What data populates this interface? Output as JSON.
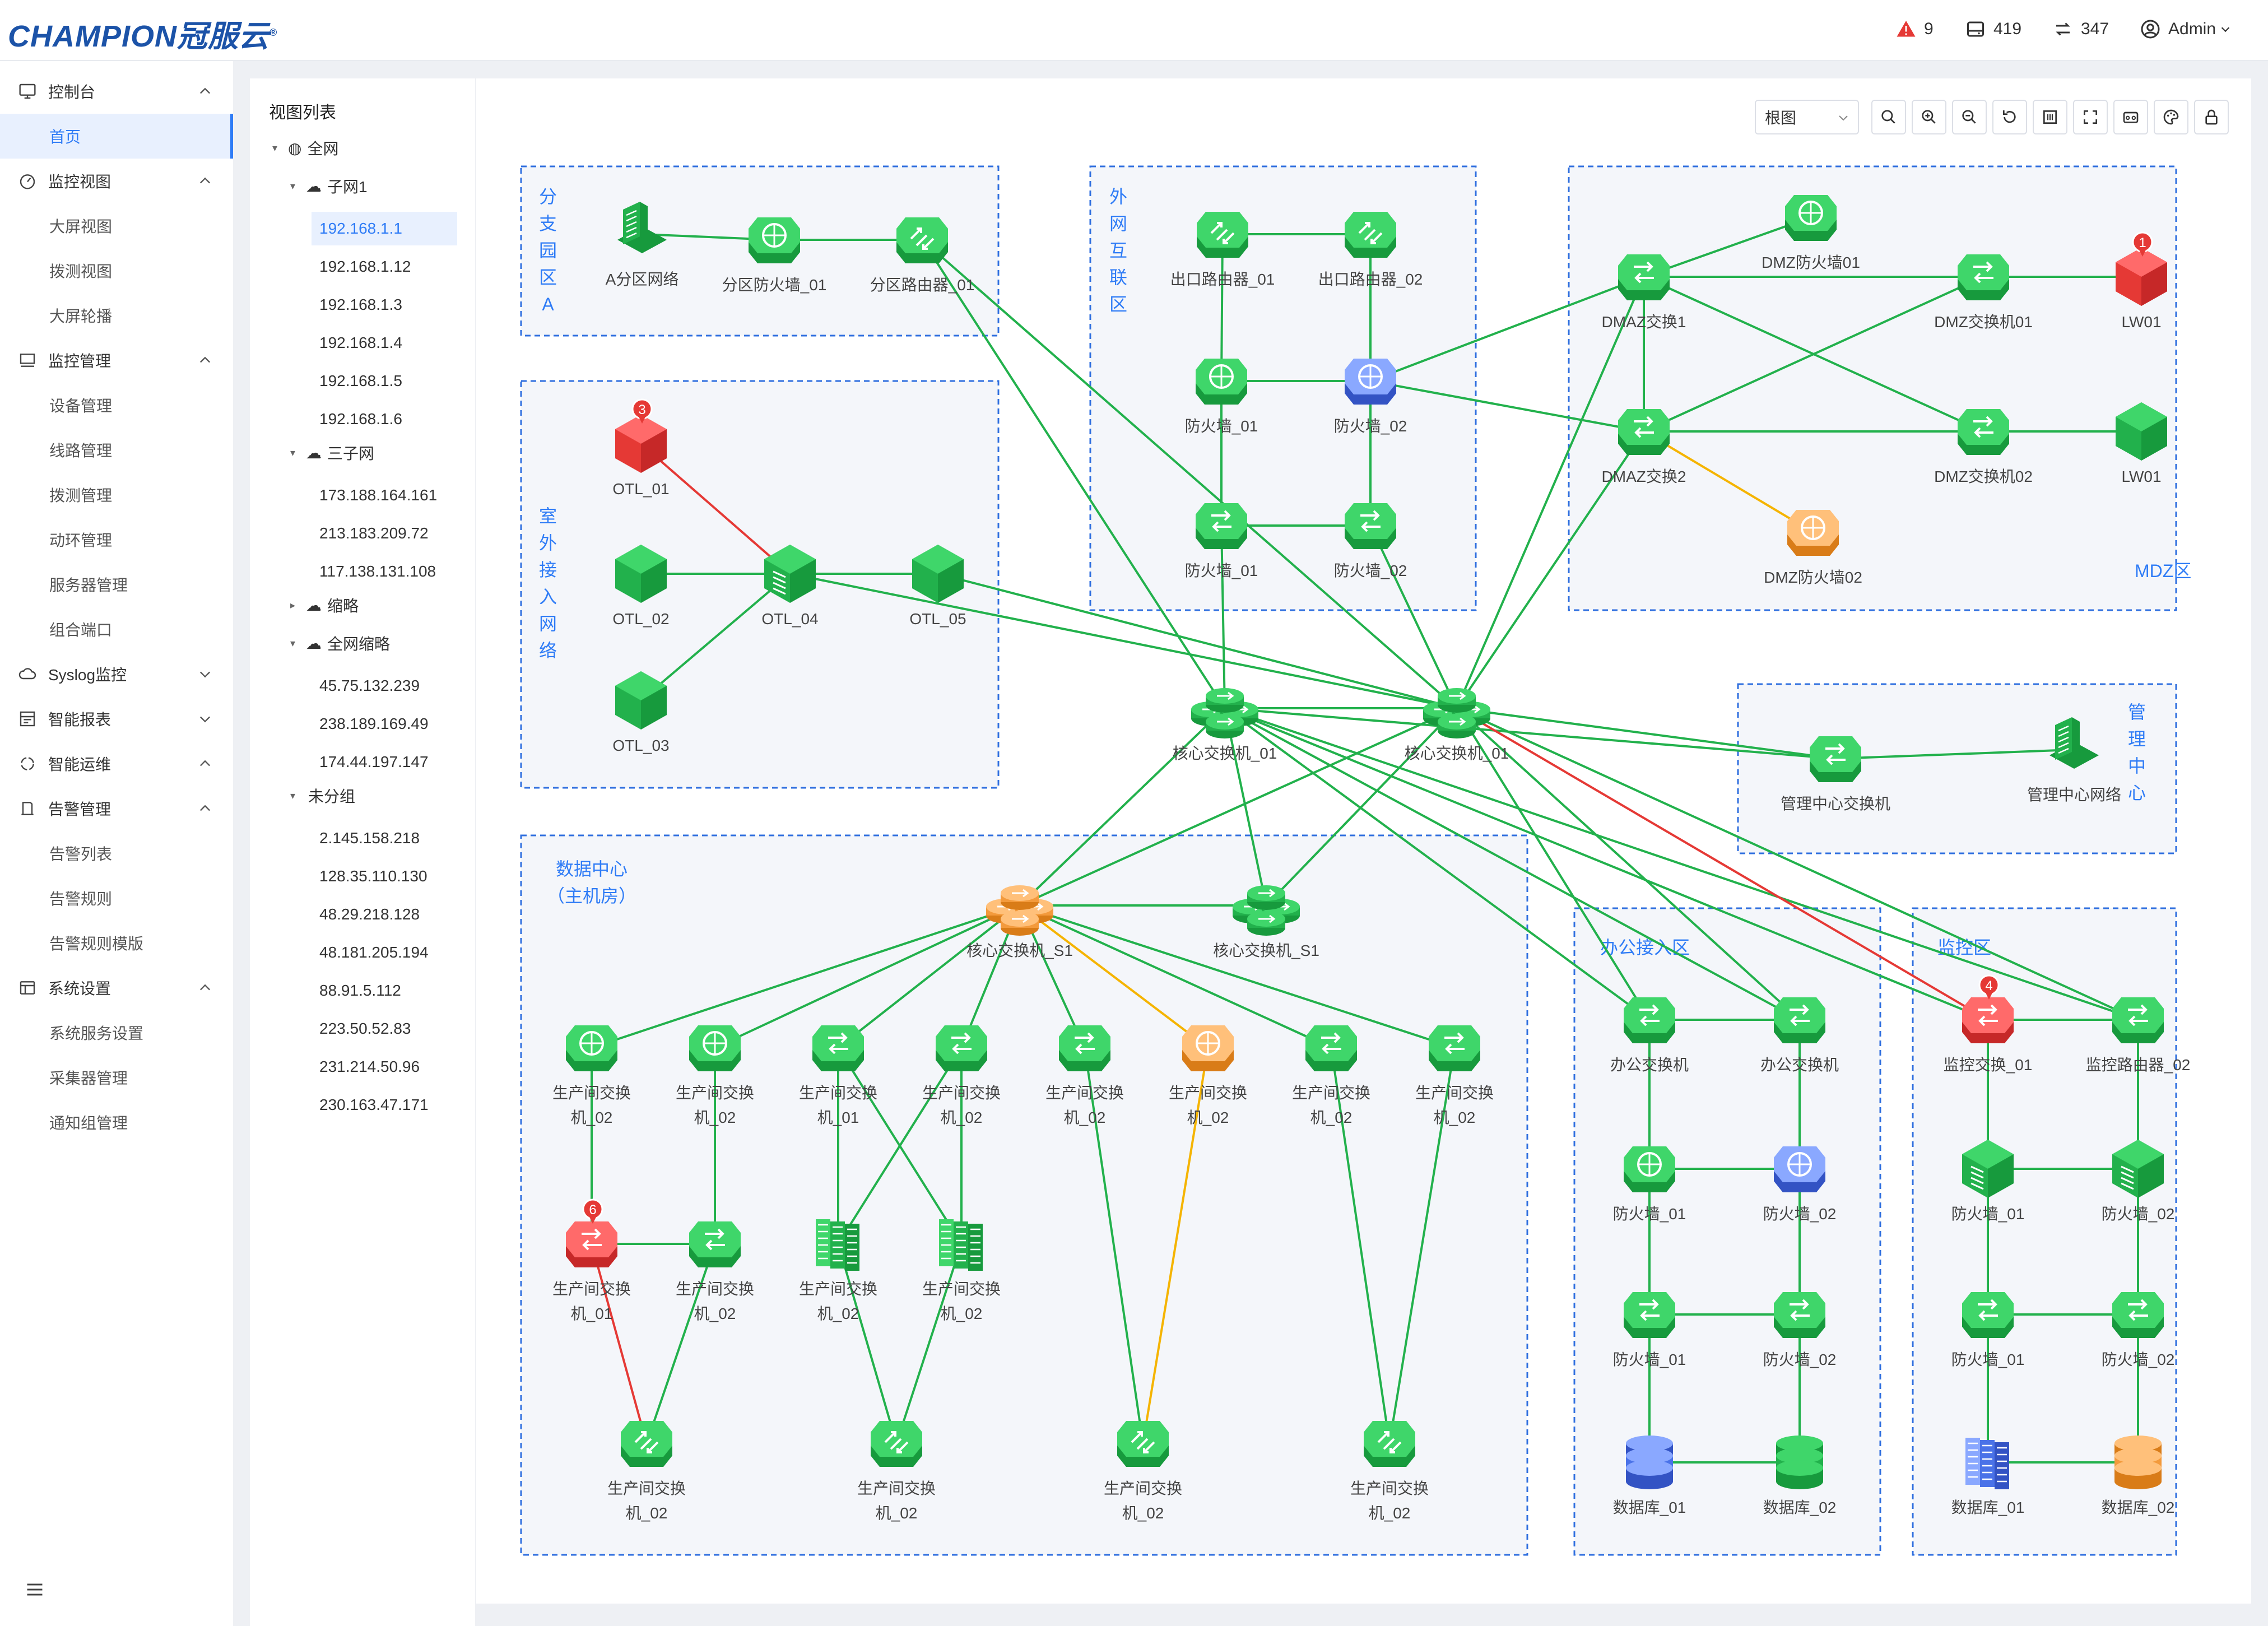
{
  "header": {
    "logo": "CHAMPION冠服云",
    "alerts": "9",
    "devices": "419",
    "links": "347",
    "user": "Admin"
  },
  "sidebar": {
    "groups": [
      {
        "label": "控制台",
        "icon": "monitor-icon",
        "expanded": true,
        "items": [
          "首页"
        ]
      },
      {
        "label": "监控视图",
        "icon": "dashboard-icon",
        "expanded": true,
        "items": [
          "大屏视图",
          "拨测视图",
          "大屏轮播"
        ]
      },
      {
        "label": "监控管理",
        "icon": "monitor-manage-icon",
        "expanded": true,
        "items": [
          "设备管理",
          "线路管理",
          "拨测管理",
          "动环管理",
          "服务器管理",
          "组合端口"
        ]
      },
      {
        "label": "Syslog监控",
        "icon": "syslog-icon",
        "expanded": false,
        "items": []
      },
      {
        "label": "智能报表",
        "icon": "report-icon",
        "expanded": false,
        "items": []
      },
      {
        "label": "智能运维",
        "icon": "ops-icon",
        "expanded": true,
        "items": []
      },
      {
        "label": "告警管理",
        "icon": "alarm-icon",
        "expanded": true,
        "items": [
          "告警列表",
          "告警规则",
          "告警规则模版"
        ]
      },
      {
        "label": "系统设置",
        "icon": "settings-icon",
        "expanded": true,
        "items": [
          "系统服务设置",
          "采集器管理",
          "通知组管理"
        ]
      }
    ],
    "active_item": "首页"
  },
  "tree": {
    "title": "视图列表",
    "root": "全网",
    "groups": [
      {
        "label": "子网1",
        "expanded": true,
        "ips": [
          "192.168.1.1",
          "192.168.1.12",
          "192.168.1.3",
          "192.168.1.4",
          "192.168.1.5",
          "192.168.1.6"
        ]
      },
      {
        "label": "三子网",
        "expanded": true,
        "ips": [
          "173.188.164.161",
          "213.183.209.72",
          "117.138.131.108"
        ]
      },
      {
        "label": "缩略",
        "expanded": false,
        "ips": []
      },
      {
        "label": "全网缩略",
        "expanded": true,
        "ips": [
          "45.75.132.239",
          "238.189.169.49",
          "174.44.197.147"
        ]
      },
      {
        "label": "未分组",
        "expanded": true,
        "ips": [
          "2.145.158.218",
          "128.35.110.130",
          "48.29.218.128",
          "48.181.205.194",
          "88.91.5.112",
          "223.50.52.83",
          "231.214.50.96",
          "230.163.47.171"
        ]
      }
    ],
    "selected": "192.168.1.1"
  },
  "toolbar": {
    "view_select": "根图",
    "buttons": [
      "search-icon",
      "zoom-in-icon",
      "zoom-out-icon",
      "refresh-icon",
      "grid-icon",
      "fullscreen-icon",
      "export-icon",
      "palette-icon",
      "lock-icon"
    ]
  },
  "colors": {
    "link_ok": "#22b14c",
    "link_down": "#e53935",
    "link_warn": "#f5b400",
    "zone_border": "#2f6fdf",
    "accent": "#2f7cf6"
  },
  "zones": [
    {
      "id": "branch-a",
      "label": "分支园区A"
    },
    {
      "id": "external",
      "label": "外网互联区"
    },
    {
      "id": "mdz",
      "label": "MDZ区"
    },
    {
      "id": "outdoor",
      "label": "室外接入网络"
    },
    {
      "id": "mgmt",
      "label": "管理中心"
    },
    {
      "id": "dc",
      "label": "数据中心（主机房）"
    },
    {
      "id": "office",
      "label": "办公接入区"
    },
    {
      "id": "monitor",
      "label": "监控区"
    }
  ],
  "nodes": [
    {
      "id": "a1",
      "label": "A分区网络",
      "type": "server",
      "status": "ok"
    },
    {
      "id": "a2",
      "label": "分区防火墙_01",
      "type": "firewall",
      "status": "ok"
    },
    {
      "id": "a3",
      "label": "分区路由器_01",
      "type": "router",
      "status": "ok"
    },
    {
      "id": "e1",
      "label": "出口路由器_01",
      "type": "router",
      "status": "ok"
    },
    {
      "id": "e2",
      "label": "出口路由器_02",
      "type": "router",
      "status": "ok"
    },
    {
      "id": "e3",
      "label": "防火墙_01",
      "type": "firewall",
      "status": "ok"
    },
    {
      "id": "e4",
      "label": "防火墙_02",
      "type": "firewall",
      "status": "info"
    },
    {
      "id": "e5",
      "label": "防火墙_01",
      "type": "switch",
      "status": "ok"
    },
    {
      "id": "e6",
      "label": "防火墙_02",
      "type": "switch",
      "status": "ok"
    },
    {
      "id": "m1",
      "label": "DMAZ交换1",
      "type": "switch",
      "status": "ok"
    },
    {
      "id": "m2",
      "label": "DMAZ交换2",
      "type": "switch",
      "status": "ok"
    },
    {
      "id": "m3",
      "label": "DMZ防火墙01",
      "type": "firewall",
      "status": "ok"
    },
    {
      "id": "m4",
      "label": "DMZ防火墙02",
      "type": "firewall",
      "status": "warn"
    },
    {
      "id": "m5",
      "label": "DMZ交换机01",
      "type": "switch",
      "status": "ok"
    },
    {
      "id": "m6",
      "label": "DMZ交换机02",
      "type": "switch",
      "status": "ok"
    },
    {
      "id": "m7",
      "label": "LW01",
      "type": "cube",
      "status": "down",
      "badge": "1"
    },
    {
      "id": "m8",
      "label": "LW01",
      "type": "cube",
      "status": "ok"
    },
    {
      "id": "o1",
      "label": "OTL_01",
      "type": "cube",
      "status": "down",
      "badge": "3"
    },
    {
      "id": "o2",
      "label": "OTL_02",
      "type": "cube",
      "status": "ok"
    },
    {
      "id": "o3",
      "label": "OTL_03",
      "type": "cube",
      "status": "ok"
    },
    {
      "id": "o4",
      "label": "OTL_04",
      "type": "cubeserver",
      "status": "ok"
    },
    {
      "id": "o5",
      "label": "OTL_05",
      "type": "cube",
      "status": "ok"
    },
    {
      "id": "c1",
      "label": "核心交换机_01",
      "type": "core",
      "status": "ok"
    },
    {
      "id": "c2",
      "label": "核心交换机_01",
      "type": "core",
      "status": "ok"
    },
    {
      "id": "g1",
      "label": "管理中心交换机",
      "type": "switch",
      "status": "ok"
    },
    {
      "id": "g2",
      "label": "管理中心网络",
      "type": "server",
      "status": "ok"
    },
    {
      "id": "s1",
      "label": "核心交换机_S1",
      "type": "core",
      "status": "warn"
    },
    {
      "id": "s2",
      "label": "核心交换机_S1",
      "type": "core",
      "status": "ok"
    },
    {
      "id": "d1",
      "label": "生产间交换机_02",
      "type": "firewall",
      "status": "ok"
    },
    {
      "id": "d2",
      "label": "生产间交换机_02",
      "type": "firewall",
      "status": "ok"
    },
    {
      "id": "d3",
      "label": "生产间交换机_01",
      "type": "switch",
      "status": "ok"
    },
    {
      "id": "d4",
      "label": "生产间交换机_02",
      "type": "switch",
      "status": "ok"
    },
    {
      "id": "d5",
      "label": "生产间交换机_02",
      "type": "switch",
      "status": "ok"
    },
    {
      "id": "d6",
      "label": "生产间交换机_02",
      "type": "firewall",
      "status": "warn"
    },
    {
      "id": "d7",
      "label": "生产间交换机_02",
      "type": "switch",
      "status": "ok"
    },
    {
      "id": "d8",
      "label": "生产间交换机_02",
      "type": "switch",
      "status": "ok"
    },
    {
      "id": "d9",
      "label": "生产间交换机_01",
      "type": "switch",
      "status": "down",
      "badge": "6"
    },
    {
      "id": "d10",
      "label": "生产间交换机_02",
      "type": "switch",
      "status": "ok"
    },
    {
      "id": "d11",
      "label": "生产间交换机_02",
      "type": "rack",
      "status": "ok"
    },
    {
      "id": "d12",
      "label": "生产间交换机_02",
      "type": "rack",
      "status": "ok"
    },
    {
      "id": "d13",
      "label": "生产间交换机_02",
      "type": "router",
      "status": "ok"
    },
    {
      "id": "d14",
      "label": "生产间交换机_02",
      "type": "router",
      "status": "ok"
    },
    {
      "id": "d15",
      "label": "生产间交换机_02",
      "type": "router",
      "status": "ok"
    },
    {
      "id": "d16",
      "label": "生产间交换机_02",
      "type": "router",
      "status": "ok"
    },
    {
      "id": "f1",
      "label": "办公交换机",
      "type": "switch",
      "status": "ok"
    },
    {
      "id": "f2",
      "label": "办公交换机",
      "type": "switch",
      "status": "ok"
    },
    {
      "id": "f3",
      "label": "防火墙_01",
      "type": "firewall",
      "status": "ok"
    },
    {
      "id": "f4",
      "label": "防火墙_02",
      "type": "firewall",
      "status": "info"
    },
    {
      "id": "f5",
      "label": "防火墙_01",
      "type": "switch",
      "status": "ok"
    },
    {
      "id": "f6",
      "label": "防火墙_02",
      "type": "switch",
      "status": "ok"
    },
    {
      "id": "f7",
      "label": "数据库_01",
      "type": "db",
      "status": "info"
    },
    {
      "id": "f8",
      "label": "数据库_02",
      "type": "db",
      "status": "ok"
    },
    {
      "id": "v1",
      "label": "监控交换_01",
      "type": "switch",
      "status": "down",
      "badge": "4"
    },
    {
      "id": "v2",
      "label": "监控路由器_02",
      "type": "switch",
      "status": "ok"
    },
    {
      "id": "v3",
      "label": "防火墙_01",
      "type": "cubeserver",
      "status": "ok"
    },
    {
      "id": "v4",
      "label": "防火墙_02",
      "type": "cubeserver",
      "status": "ok"
    },
    {
      "id": "v5",
      "label": "防火墙_01",
      "type": "switch",
      "status": "ok"
    },
    {
      "id": "v6",
      "label": "防火墙_02",
      "type": "switch",
      "status": "ok"
    },
    {
      "id": "v7",
      "label": "数据库_01",
      "type": "rack",
      "status": "info"
    },
    {
      "id": "v8",
      "label": "数据库_02",
      "type": "db",
      "status": "warn"
    }
  ],
  "links": [
    [
      "a1",
      "a2",
      "ok"
    ],
    [
      "a2",
      "a3",
      "ok"
    ],
    [
      "a3",
      "c1",
      "ok"
    ],
    [
      "a3",
      "c2",
      "ok"
    ],
    [
      "e1",
      "e2",
      "ok"
    ],
    [
      "e1",
      "e3",
      "ok"
    ],
    [
      "e3",
      "e4",
      "ok"
    ],
    [
      "e2",
      "e4",
      "ok"
    ],
    [
      "e3",
      "e5",
      "ok"
    ],
    [
      "e4",
      "e6",
      "ok"
    ],
    [
      "e5",
      "e6",
      "ok"
    ],
    [
      "e5",
      "c1",
      "ok"
    ],
    [
      "e6",
      "c2",
      "ok"
    ],
    [
      "e4",
      "m1",
      "ok"
    ],
    [
      "e4",
      "m2",
      "ok"
    ],
    [
      "m1",
      "m2",
      "ok"
    ],
    [
      "m1",
      "m3",
      "ok"
    ],
    [
      "m1",
      "m5",
      "ok"
    ],
    [
      "m1",
      "m6",
      "ok"
    ],
    [
      "m2",
      "m5",
      "ok"
    ],
    [
      "m2",
      "m6",
      "ok"
    ],
    [
      "m2",
      "m4",
      "warn"
    ],
    [
      "m5",
      "m7",
      "ok"
    ],
    [
      "m6",
      "m8",
      "ok"
    ],
    [
      "m1",
      "c2",
      "ok"
    ],
    [
      "m2",
      "c2",
      "ok"
    ],
    [
      "o1",
      "o4",
      "down"
    ],
    [
      "o2",
      "o4",
      "ok"
    ],
    [
      "o3",
      "o4",
      "ok"
    ],
    [
      "o4",
      "o5",
      "ok"
    ],
    [
      "o4",
      "c2",
      "ok"
    ],
    [
      "o5",
      "c2",
      "ok"
    ],
    [
      "c1",
      "c2",
      "ok"
    ],
    [
      "c1",
      "g1",
      "ok"
    ],
    [
      "c2",
      "g1",
      "ok"
    ],
    [
      "g1",
      "g2",
      "ok"
    ],
    [
      "c1",
      "s1",
      "ok"
    ],
    [
      "c1",
      "s2",
      "ok"
    ],
    [
      "c2",
      "s1",
      "ok"
    ],
    [
      "c2",
      "s2",
      "ok"
    ],
    [
      "s1",
      "s2",
      "ok"
    ],
    [
      "c1",
      "f1",
      "ok"
    ],
    [
      "c1",
      "f2",
      "ok"
    ],
    [
      "c2",
      "f1",
      "ok"
    ],
    [
      "c2",
      "f2",
      "ok"
    ],
    [
      "c1",
      "v1",
      "ok"
    ],
    [
      "c1",
      "v2",
      "ok"
    ],
    [
      "c2",
      "v1",
      "down"
    ],
    [
      "c2",
      "v2",
      "ok"
    ],
    [
      "s1",
      "d1",
      "ok"
    ],
    [
      "s1",
      "d2",
      "ok"
    ],
    [
      "s1",
      "d3",
      "ok"
    ],
    [
      "s1",
      "d4",
      "ok"
    ],
    [
      "s1",
      "d5",
      "ok"
    ],
    [
      "s1",
      "d6",
      "warn"
    ],
    [
      "s1",
      "d7",
      "ok"
    ],
    [
      "s1",
      "d8",
      "ok"
    ],
    [
      "d1",
      "d9",
      "ok"
    ],
    [
      "d2",
      "d10",
      "ok"
    ],
    [
      "d9",
      "d10",
      "ok"
    ],
    [
      "d3",
      "d11",
      "ok"
    ],
    [
      "d3",
      "d12",
      "ok"
    ],
    [
      "d4",
      "d11",
      "ok"
    ],
    [
      "d4",
      "d12",
      "ok"
    ],
    [
      "d9",
      "d13",
      "down"
    ],
    [
      "d10",
      "d13",
      "ok"
    ],
    [
      "d11",
      "d14",
      "ok"
    ],
    [
      "d12",
      "d14",
      "ok"
    ],
    [
      "d5",
      "d15",
      "ok"
    ],
    [
      "d6",
      "d15",
      "warn"
    ],
    [
      "d7",
      "d16",
      "ok"
    ],
    [
      "d8",
      "d16",
      "ok"
    ],
    [
      "f1",
      "f2",
      "ok"
    ],
    [
      "f1",
      "f3",
      "ok"
    ],
    [
      "f2",
      "f4",
      "ok"
    ],
    [
      "f3",
      "f4",
      "ok"
    ],
    [
      "f3",
      "f5",
      "ok"
    ],
    [
      "f4",
      "f6",
      "ok"
    ],
    [
      "f5",
      "f6",
      "ok"
    ],
    [
      "f5",
      "f7",
      "ok"
    ],
    [
      "f6",
      "f8",
      "ok"
    ],
    [
      "f7",
      "f8",
      "ok"
    ],
    [
      "v1",
      "v2",
      "ok"
    ],
    [
      "v1",
      "v3",
      "ok"
    ],
    [
      "v2",
      "v4",
      "ok"
    ],
    [
      "v3",
      "v4",
      "ok"
    ],
    [
      "v3",
      "v5",
      "ok"
    ],
    [
      "v4",
      "v6",
      "ok"
    ],
    [
      "v5",
      "v6",
      "ok"
    ],
    [
      "v5",
      "v7",
      "ok"
    ],
    [
      "v6",
      "v8",
      "ok"
    ],
    [
      "v7",
      "v8",
      "ok"
    ]
  ]
}
